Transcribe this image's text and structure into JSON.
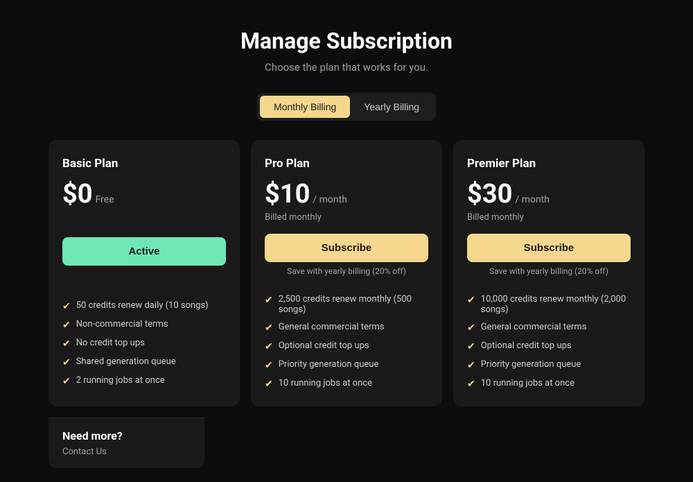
{
  "header": {
    "title": "Manage Subscription",
    "subtitle": "Choose the plan that works for you."
  },
  "billing_toggle": {
    "monthly_label": "Monthly Billing",
    "yearly_label": "Yearly Billing"
  },
  "plans": [
    {
      "id": "basic",
      "name": "Basic Plan",
      "price": "$0",
      "price_suffix": "Free",
      "billing_info": "",
      "cta_label": "Active",
      "cta_type": "active",
      "save_text": "",
      "features": [
        "50 credits renew daily (10 songs)",
        "Non-commercial terms",
        "No credit top ups",
        "Shared generation queue",
        "2 running jobs at once"
      ]
    },
    {
      "id": "pro",
      "name": "Pro Plan",
      "price": "$10",
      "price_suffix": "/ month",
      "billing_info": "Billed monthly",
      "cta_label": "Subscribe",
      "cta_type": "subscribe",
      "save_text": "Save with yearly billing (20% off)",
      "features": [
        "2,500 credits renew monthly (500 songs)",
        "General commercial terms",
        "Optional credit top ups",
        "Priority generation queue",
        "10 running jobs at once"
      ]
    },
    {
      "id": "premier",
      "name": "Premier Plan",
      "price": "$30",
      "price_suffix": "/ month",
      "billing_info": "Billed monthly",
      "cta_label": "Subscribe",
      "cta_type": "subscribe",
      "save_text": "Save with yearly billing (20% off)",
      "features": [
        "10,000 credits renew monthly (2,000 songs)",
        "General commercial terms",
        "Optional credit top ups",
        "Priority generation queue",
        "10 running jobs at once"
      ]
    }
  ],
  "need_more": {
    "title": "Need more?",
    "contact_label": "Contact Us"
  }
}
